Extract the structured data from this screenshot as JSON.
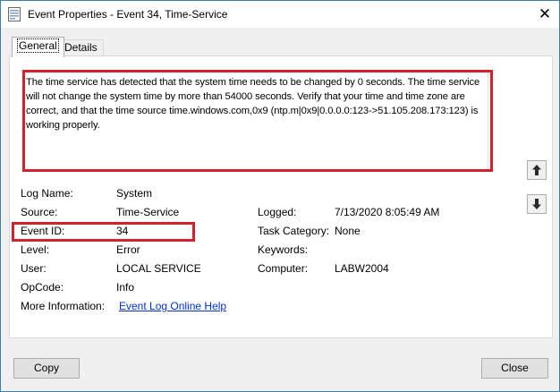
{
  "window": {
    "title": "Event Properties - Event 34, Time-Service",
    "close_glyph": "✕"
  },
  "tabs": [
    {
      "label": "General",
      "active": true
    },
    {
      "label": "Details",
      "active": false
    }
  ],
  "description": "The time service has detected that the system time needs to be  changed by 0 seconds. The time service will not change the system time by more than 54000 seconds. Verify that your time and time zone are correct, and that the time source time.windows.com,0x9 (ntp.m|0x9|0.0.0.0:123->51.105.208.173:123) is working properly.",
  "fields": {
    "log_name": {
      "label": "Log Name:",
      "value": "System"
    },
    "source": {
      "label": "Source:",
      "value": "Time-Service"
    },
    "event_id": {
      "label": "Event ID:",
      "value": "34"
    },
    "level": {
      "label": "Level:",
      "value": "Error"
    },
    "user": {
      "label": "User:",
      "value": "LOCAL SERVICE"
    },
    "opcode": {
      "label": "OpCode:",
      "value": "Info"
    },
    "more_info": {
      "label": "More Information:",
      "value": "Event Log Online Help"
    },
    "logged": {
      "label": "Logged:",
      "value": "7/13/2020 8:05:49 AM"
    },
    "task_category": {
      "label": "Task Category:",
      "value": "None"
    },
    "keywords": {
      "label": "Keywords:",
      "value": ""
    },
    "computer": {
      "label": "Computer:",
      "value": "LABW2004"
    }
  },
  "buttons": {
    "copy": "Copy",
    "close": "Close"
  },
  "colors": {
    "highlight": "#d4202a",
    "link": "#0033cc",
    "border": "#3c7fb1"
  },
  "icons": {
    "up": "arrow-up-icon",
    "down": "arrow-down-icon",
    "app": "event-log-icon"
  }
}
